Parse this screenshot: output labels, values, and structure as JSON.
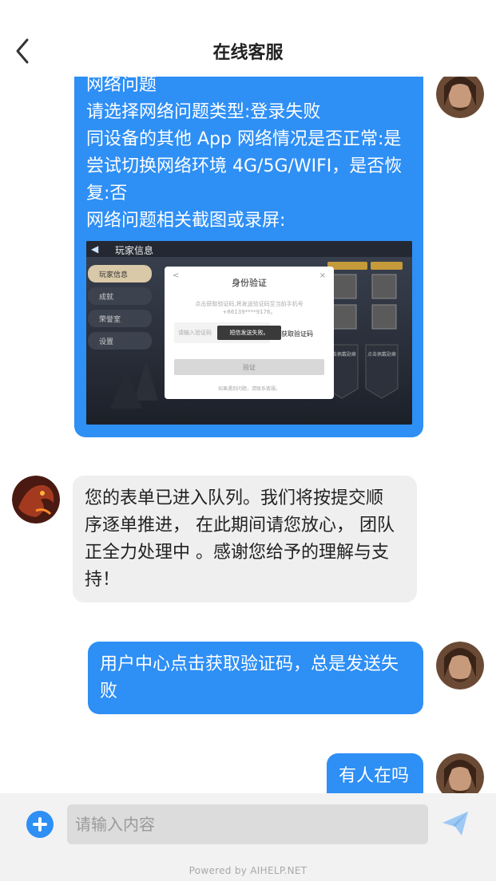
{
  "header": {
    "title": "在线客服",
    "back_icon": "chevron-left-icon"
  },
  "messages": [
    {
      "role": "user",
      "lines": [
        "网络问题",
        "请选择网络问题类型:登录失败",
        "同设备的其他 App 网络情况是否正常:是",
        "尝试切换网络环境 4G/5G/WIFI，是否恢",
        "复:否",
        "网络问题相关截图或录屏:"
      ],
      "screenshot": {
        "game_title": "玩家信息",
        "menu": [
          "玩家信息",
          "成就",
          "荣誉室",
          "设置"
        ],
        "dialog_title": "身份验证",
        "dialog_desc_1": "点击获取验证码,将发送验证码至当前手机号",
        "dialog_desc_2": "+86139****9176。",
        "code_placeholder": "请输入验证码",
        "get_code_label": "获取验证码",
        "toast": "短信发送失败。",
        "verify_label": "验证",
        "footer_note": "如果遇到问题，请联系客服。",
        "badge_1": "点击佩戴勋章",
        "badge_2": "点击佩戴勋章"
      }
    },
    {
      "role": "agent",
      "lines": [
        "您的表单已进入队列。我们将按提交顺",
        "序逐单推进， 在此期间请您放心， 团队",
        "正全力处理中 。感谢您给予的理解与支",
        "持！"
      ]
    },
    {
      "role": "user",
      "lines": [
        "用户中心点击获取验证码，总是发送失",
        "败"
      ]
    },
    {
      "role": "user",
      "lines": [
        "有人在吗"
      ]
    }
  ],
  "input": {
    "placeholder": "请输入内容"
  },
  "footer": {
    "powered": "Powered by AIHELP.NET"
  },
  "colors": {
    "accent": "#2e8ff5",
    "agent_bubble": "#efefef",
    "input_bar": "#f2f2f2"
  }
}
